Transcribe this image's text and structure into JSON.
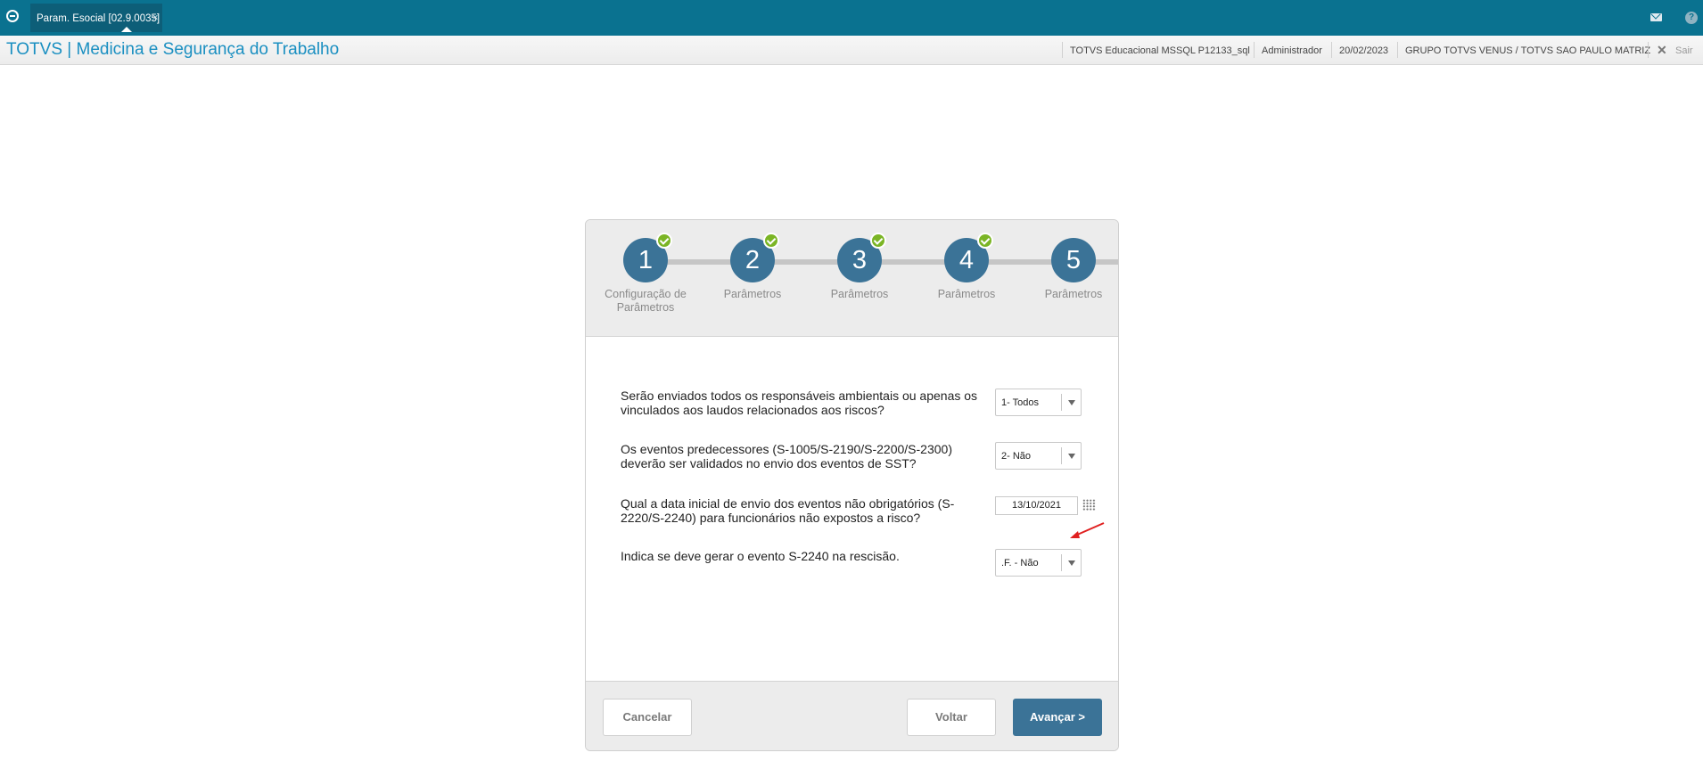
{
  "topbar": {
    "tab_label": "Param. Esocial [02.9.0035]",
    "tab_close": "×",
    "help_label": "?"
  },
  "header": {
    "title": "TOTVS | Medicina e Segurança do Trabalho",
    "environment": "TOTVS Educacional MSSQL P12133_sql",
    "user": "Administrador",
    "date": "20/02/2023",
    "company": "GRUPO TOTVS VENUS / TOTVS SAO PAULO MATRIZ",
    "exit_label": "Sair"
  },
  "wizard": {
    "steps": [
      {
        "number": "1",
        "label": "Configuração de Parâmetros",
        "completed": true
      },
      {
        "number": "2",
        "label": "Parâmetros",
        "completed": true
      },
      {
        "number": "3",
        "label": "Parâmetros",
        "completed": true
      },
      {
        "number": "4",
        "label": "Parâmetros",
        "completed": true
      },
      {
        "number": "5",
        "label": "Parâmetros",
        "completed": false
      }
    ],
    "questions": [
      {
        "text": "Serão enviados todos os responsáveis ambientais ou apenas os vinculados aos laudos relacionados aos riscos?",
        "value": "1- Todos"
      },
      {
        "text": "Os eventos predecessores (S-1005/S-2190/S-2200/S-2300) deverão ser validados no envio dos eventos de SST?",
        "value": "2- Não"
      },
      {
        "text": "Qual a data inicial de envio dos eventos não obrigatórios (S-2220/S-2240) para funcionários não expostos a risco?",
        "value": "13/10/2021"
      },
      {
        "text": "Indica se deve gerar o evento S-2240 na rescisão.",
        "value": ".F. - Não"
      }
    ],
    "buttons": {
      "cancel": "Cancelar",
      "back": "Voltar",
      "next": "Avançar >"
    }
  },
  "colors": {
    "topbar": "#0a7290",
    "title": "#1a8fc1",
    "step_circle": "#3b7397",
    "check": "#7bb525",
    "annotation_arrow": "#e02020"
  }
}
